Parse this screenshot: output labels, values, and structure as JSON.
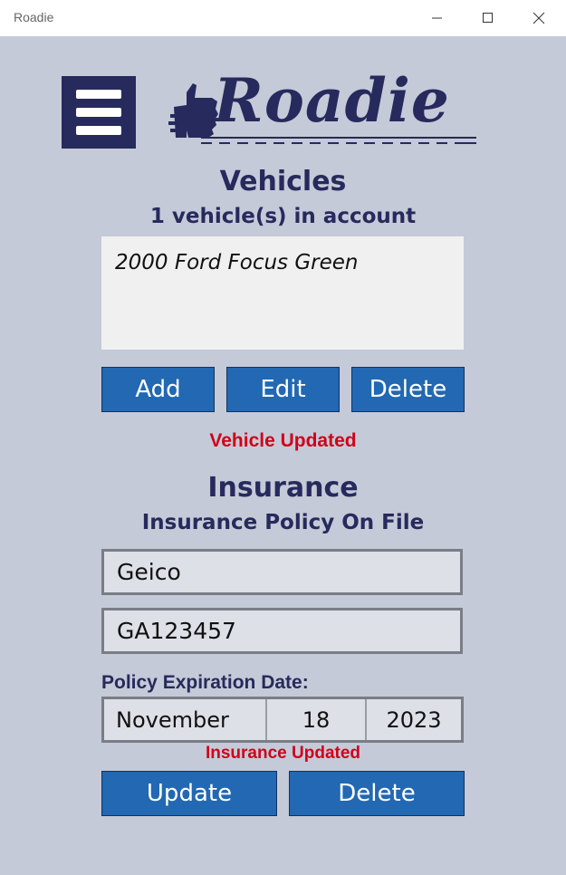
{
  "window": {
    "title": "Roadie",
    "controls": [
      "minimize-icon",
      "maximize-icon",
      "close-icon"
    ]
  },
  "header": {
    "menu_icon": "hamburger-menu-icon",
    "logo_text": "Roadie",
    "logo_icon": "thumbs-up-icon"
  },
  "vehicles": {
    "title": "Vehicles",
    "subtitle": "1 vehicle(s) in account",
    "items": [
      "2000 Ford Focus Green"
    ],
    "buttons": {
      "add": "Add",
      "edit": "Edit",
      "delete": "Delete"
    },
    "status": "Vehicle Updated"
  },
  "insurance": {
    "title": "Insurance",
    "subtitle": "Insurance Policy On File",
    "provider": "Geico",
    "policy_number": "GA123457",
    "expiration_label": "Policy Expiration Date:",
    "expiration": {
      "month": "November",
      "day": "18",
      "year": "2023"
    },
    "status": "Insurance Updated",
    "buttons": {
      "update": "Update",
      "delete": "Delete"
    }
  },
  "colors": {
    "background": "#c5cad8",
    "brand_navy": "#272a5c",
    "button_blue": "#2268b2",
    "status_red": "#d0021b"
  }
}
